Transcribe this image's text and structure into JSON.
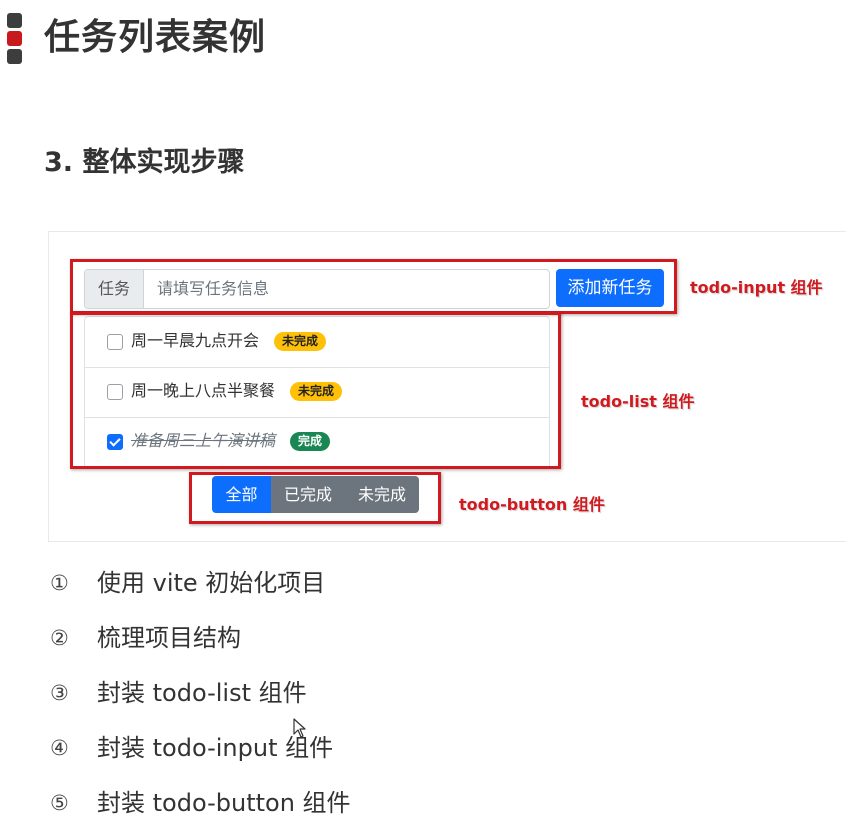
{
  "page": {
    "title": "任务列表案例",
    "section_title": "3. 整体实现步骤"
  },
  "demo": {
    "input_prefix": "任务",
    "input_placeholder": "请填写任务信息",
    "add_button": "添加新任务",
    "items": [
      {
        "text": "周一早晨九点开会",
        "badge": "未完成",
        "done": false
      },
      {
        "text": "周一晚上八点半聚餐",
        "badge": "未完成",
        "done": false
      },
      {
        "text": "准备周三上午演讲稿",
        "badge": "完成",
        "done": true
      }
    ],
    "filter_buttons": [
      "全部",
      "已完成",
      "未完成"
    ],
    "annotations": {
      "input": "todo-input 组件",
      "list": "todo-list 组件",
      "button": "todo-button 组件"
    },
    "colors": {
      "primary": "#0d6efd",
      "secondary": "#6c757d",
      "warning": "#ffc107",
      "success": "#198754",
      "annotation": "#d11a1f"
    }
  },
  "steps": [
    {
      "num": "①",
      "text": "使用 vite 初始化项目"
    },
    {
      "num": "②",
      "text": "梳理项目结构"
    },
    {
      "num": "③",
      "text": "封装 todo-list 组件"
    },
    {
      "num": "④",
      "text": "封装 todo-input 组件"
    },
    {
      "num": "⑤",
      "text": "封装 todo-button 组件"
    }
  ]
}
